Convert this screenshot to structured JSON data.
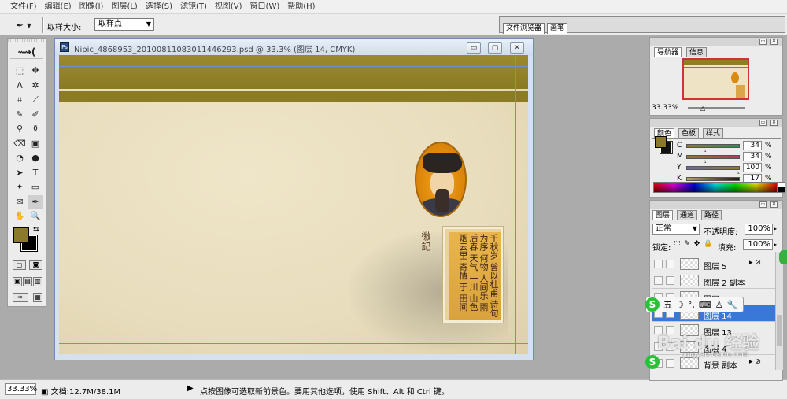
{
  "menu": [
    "文件(F)",
    "编辑(E)",
    "图像(I)",
    "图层(L)",
    "选择(S)",
    "滤镜(T)",
    "视图(V)",
    "窗口(W)",
    "帮助(H)"
  ],
  "options": {
    "tool_icon": "eyedropper-icon",
    "tool_glyph": "✒ ▾",
    "sample_label": "取样大小:",
    "sample_value": "取样点",
    "well_tabs": [
      "文件浏览器",
      "画笔"
    ]
  },
  "toolbox": {
    "logo": "⟿(",
    "tools": [
      "⬚",
      "✥",
      "ⴷ",
      "✲",
      "⌗",
      "⟋",
      "✎",
      "✐",
      "⚲",
      "⚱",
      "⌫",
      "▣",
      "◔",
      "●",
      "➤",
      "T",
      "✦",
      "▭",
      "✉",
      "✒",
      "✋",
      "🔍"
    ],
    "swap_glyph": "⇆",
    "mask_buttons": [
      "▢",
      "◙"
    ],
    "screen_buttons": [
      "▣",
      "▤",
      "▥"
    ],
    "jump_buttons": [
      "⇨",
      "▦"
    ]
  },
  "document": {
    "title": "Nipic_4868953_20100811083011446293.psd @ 33.3% (图层 14, CMYK)",
    "icon_glyph": "Ps",
    "buttons": [
      "▭",
      "▢",
      "✕"
    ],
    "seal_text": "徽記",
    "calligraphy": "千秋岁 曾以杜甫 诗句 为序 何物 人间乐 雨后春 天气 一川 山色 烟云里 寄情 于 田间"
  },
  "status": {
    "zoom": "33.33%",
    "doc_icon": "▣",
    "doc_info": "文档:12.7M/38.1M",
    "arrow": "▶",
    "hint": "点按图像可选取新前景色。要用其他选项，使用 Shift、Alt 和 Ctrl 键。"
  },
  "navigator": {
    "tabs": [
      "导航器",
      "信息"
    ],
    "zoom": "33.33%",
    "buttons": [
      "▭",
      "✕"
    ]
  },
  "color": {
    "tabs": [
      "颜色",
      "色板",
      "样式"
    ],
    "channels": [
      {
        "label": "C",
        "value": "34",
        "unit": "%",
        "gradient": "linear-gradient(90deg,#8c7a2c,#2e8b57)",
        "pos": 0.34
      },
      {
        "label": "M",
        "value": "34",
        "unit": "%",
        "gradient": "linear-gradient(90deg,#8c7a2c,#b03a5a)",
        "pos": 0.34
      },
      {
        "label": "Y",
        "value": "100",
        "unit": "%",
        "gradient": "linear-gradient(90deg,#6a6aa0,#8c7a2c)",
        "pos": 1.0
      },
      {
        "label": "K",
        "value": "17",
        "unit": "%",
        "gradient": "linear-gradient(90deg,#b9a45a,#1a1a1a)",
        "pos": 0.17
      }
    ],
    "fg_color": "#8c7a2c",
    "bg_color": "#111111"
  },
  "layers": {
    "tabs": [
      "图层",
      "通道",
      "路径"
    ],
    "blend_mode": "正常",
    "opacity_label": "不透明度:",
    "opacity": "100%",
    "lock_label": "锁定:",
    "lock_icons": "⬚ ✎ ✥ 🔒",
    "fill_label": "填充:",
    "fill": "100%",
    "items": [
      {
        "name": "图层 5",
        "fx": "▸ ⊘",
        "selected": false
      },
      {
        "name": "图层 2 副本",
        "fx": "",
        "selected": false
      },
      {
        "name": "图层 2",
        "fx": "",
        "selected": false
      },
      {
        "name": "图层 14",
        "fx": "",
        "selected": true
      },
      {
        "name": "图层 13",
        "fx": "",
        "selected": false
      },
      {
        "name": "图层 4",
        "fx": "",
        "selected": false
      },
      {
        "name": "背景 副本",
        "fx": "▸ ⊘",
        "selected": false
      }
    ],
    "buttons": [
      "▭",
      "✕"
    ]
  },
  "ime": {
    "logo": "S",
    "items": [
      "五",
      "☽",
      "°,",
      "⌨",
      "♙",
      "🔧"
    ]
  },
  "watermark": {
    "main": "Bai du 经验",
    "url": "jingyan.baidu.com"
  }
}
